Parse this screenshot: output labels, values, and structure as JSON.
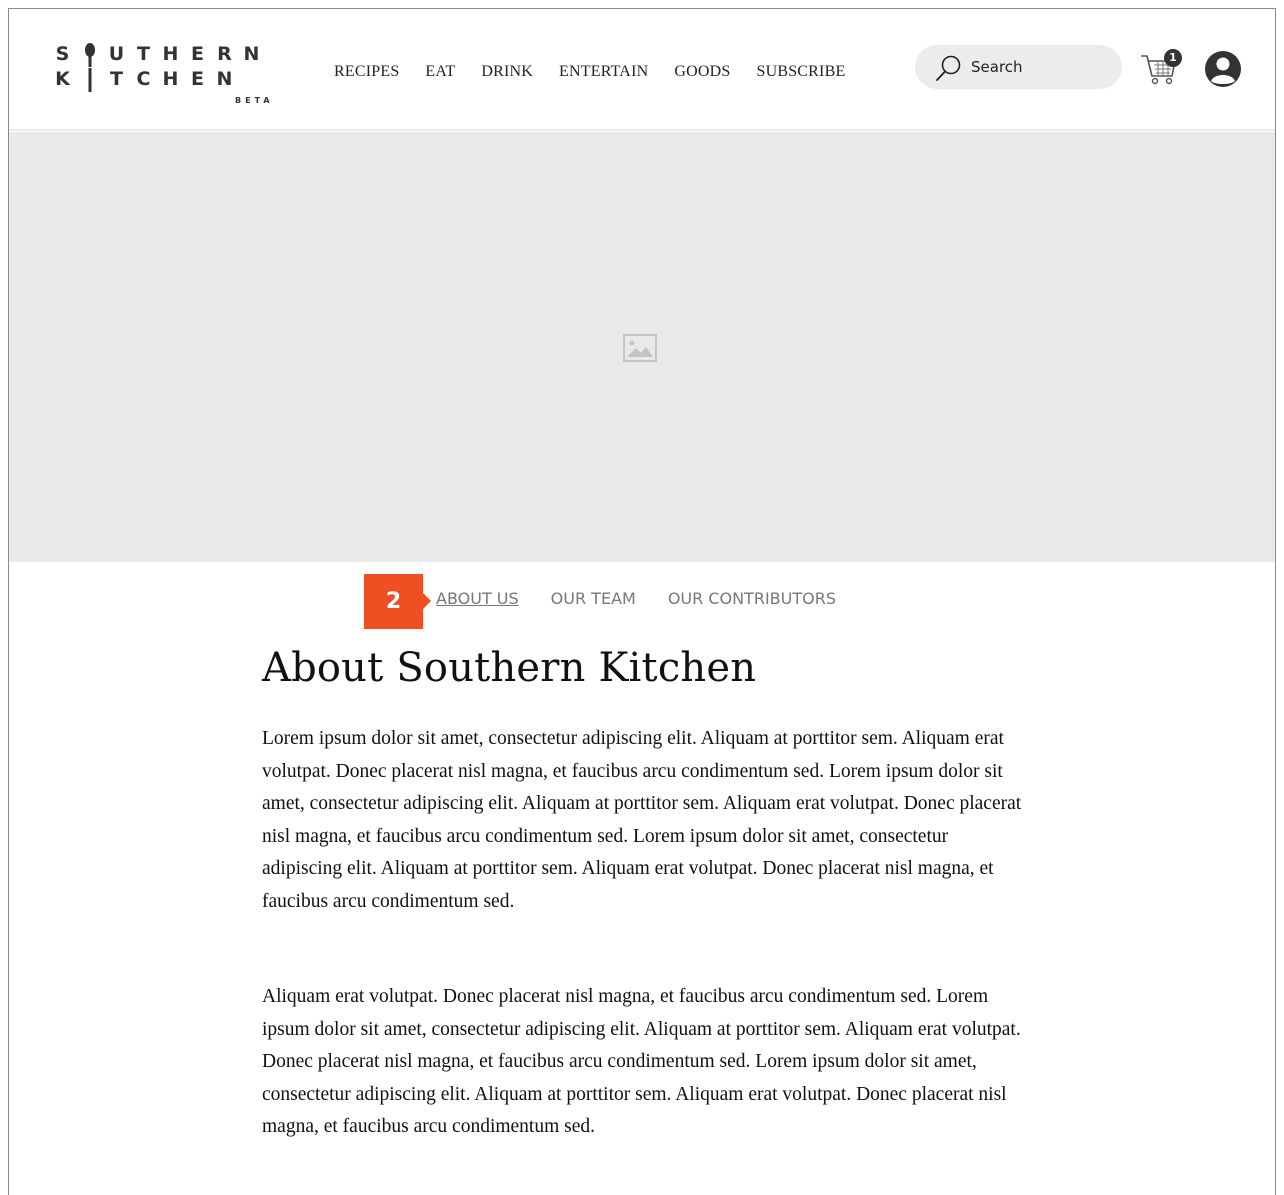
{
  "brand": {
    "logo_row1": [
      "S",
      "",
      "U",
      "T",
      "H",
      "E",
      "R",
      "N"
    ],
    "logo_row2": [
      "K",
      "",
      "T",
      "C",
      "H",
      "E",
      "N"
    ],
    "logo_beta": "BETA"
  },
  "nav": {
    "items": [
      "RECIPES",
      "EAT",
      "DRINK",
      "ENTERTAIN",
      "GOODS",
      "SUBSCRIBE"
    ]
  },
  "search": {
    "placeholder": "Search"
  },
  "cart": {
    "count": "1"
  },
  "annotation": {
    "marker": "2",
    "marker_color": "#f04e23"
  },
  "subnav": {
    "items": [
      "ABOUT US",
      "OUR TEAM",
      "OUR CONTRIBUTORS"
    ],
    "active": "ABOUT US"
  },
  "content": {
    "title": "About Southern Kitchen",
    "paragraphs": [
      "Lorem ipsum dolor sit amet, consectetur adipiscing elit. Aliquam at porttitor sem. Aliquam erat volutpat. Donec placerat nisl magna, et faucibus arcu condimentum sed. Lorem ipsum dolor sit amet, consectetur adipiscing elit. Aliquam at porttitor sem. Aliquam erat volutpat. Donec placerat nisl magna, et faucibus arcu condimentum sed. Lorem ipsum dolor sit amet, consectetur adipiscing elit. Aliquam at porttitor sem. Aliquam erat volutpat. Donec placerat nisl magna, et faucibus arcu condimentum sed.",
      "Aliquam erat volutpat. Donec placerat nisl magna, et faucibus arcu condimentum sed. Lorem ipsum dolor sit amet, consectetur adipiscing elit. Aliquam at porttitor sem. Aliquam erat volutpat. Donec placerat nisl magna, et faucibus arcu condimentum sed. Lorem ipsum dolor sit amet, consectetur adipiscing elit. Aliquam at porttitor sem. Aliquam erat volutpat. Donec placerat nisl magna, et faucibus arcu condimentum sed."
    ]
  },
  "icons": {
    "search": "search-icon",
    "cart": "cart-icon",
    "account": "account-icon",
    "hero": "image-placeholder-icon",
    "spoon": "spoon-icon",
    "fork": "fork-icon"
  },
  "colors": {
    "accent": "#f04e23",
    "hero_bg": "#e9e9e9",
    "search_bg": "#ececec"
  }
}
